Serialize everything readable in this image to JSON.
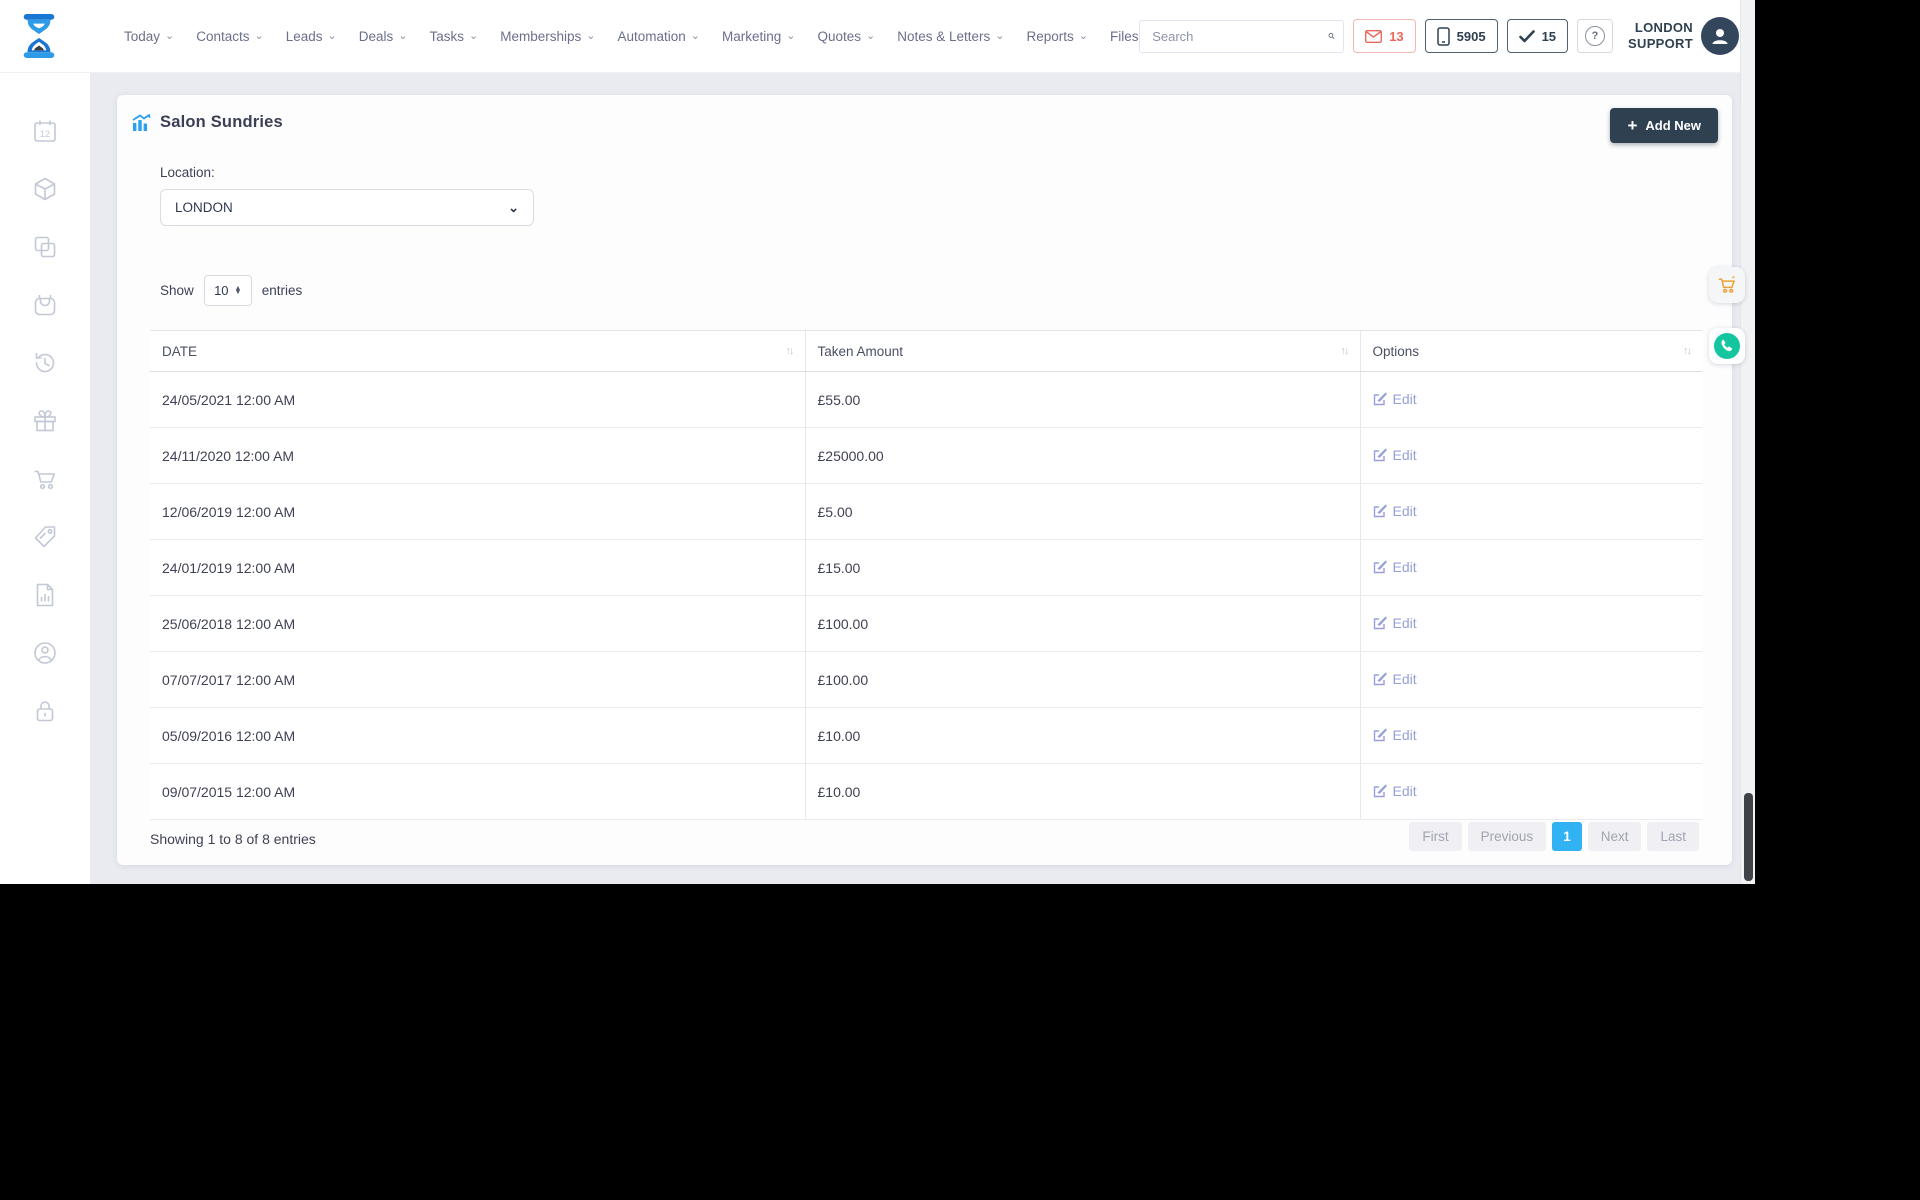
{
  "topnav": {
    "items": [
      "Today",
      "Contacts",
      "Leads",
      "Deals",
      "Tasks",
      "Memberships",
      "Automation",
      "Marketing",
      "Quotes",
      "Notes & Letters",
      "Reports",
      "Files"
    ],
    "search_placeholder": "Search",
    "badges": {
      "messages": "13",
      "phone": "5905",
      "tasks": "15"
    },
    "user": {
      "line1": "LONDON",
      "line2": "SUPPORT"
    }
  },
  "sidebar": {
    "icons": [
      "calendar-icon",
      "package-icon",
      "duplicate-icon",
      "basin-icon",
      "history-icon",
      "gift-icon",
      "cart-icon",
      "tag-icon",
      "report-icon",
      "account-icon",
      "lock-icon"
    ]
  },
  "page": {
    "title": "Salon Sundries",
    "add_new_label": "Add New",
    "location_label": "Location:",
    "location_value": "LONDON",
    "show_label": "Show",
    "show_value": "10",
    "entries_label": "entries",
    "table": {
      "columns": [
        "DATE",
        "Taken Amount",
        "Options"
      ],
      "rows": [
        {
          "date": "24/05/2021 12:00 AM",
          "amount": "£55.00",
          "action": "Edit"
        },
        {
          "date": "24/11/2020 12:00 AM",
          "amount": "£25000.00",
          "action": "Edit"
        },
        {
          "date": "12/06/2019 12:00 AM",
          "amount": "£5.00",
          "action": "Edit"
        },
        {
          "date": "24/01/2019 12:00 AM",
          "amount": "£15.00",
          "action": "Edit"
        },
        {
          "date": "25/06/2018 12:00 AM",
          "amount": "£100.00",
          "action": "Edit"
        },
        {
          "date": "07/07/2017 12:00 AM",
          "amount": "£100.00",
          "action": "Edit"
        },
        {
          "date": "05/09/2016 12:00 AM",
          "amount": "£10.00",
          "action": "Edit"
        },
        {
          "date": "09/07/2015 12:00 AM",
          "amount": "£10.00",
          "action": "Edit"
        }
      ]
    },
    "footer": {
      "summary": "Showing 1 to 8 of 8 entries",
      "pagination": [
        "First",
        "Previous",
        "1",
        "Next",
        "Last"
      ],
      "active_page": "1"
    }
  },
  "colors": {
    "navy": "#2f4050",
    "accent_blue": "#31b2f2",
    "alert_red": "#e8685f",
    "teal": "#14c6a0",
    "orange": "#f0a12e",
    "edit_link": "#97a0d9",
    "sidebar_icon": "#c2c8d5",
    "background": "#e9ebf1"
  }
}
